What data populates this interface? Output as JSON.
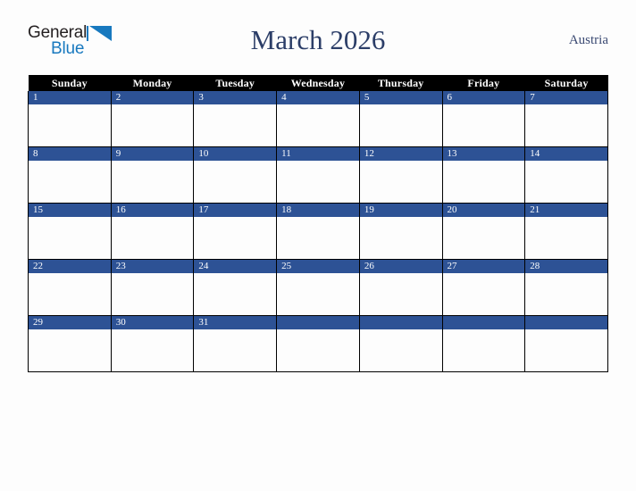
{
  "brand": {
    "name_part1": "General",
    "name_part2": "Blue",
    "accent_color": "#1879bf",
    "text_color": "#231f20"
  },
  "header": {
    "title": "March 2026",
    "region": "Austria",
    "title_color": "#2c3e68"
  },
  "calendar": {
    "month": "March",
    "year": "2026",
    "weekday_headers": [
      "Sunday",
      "Monday",
      "Tuesday",
      "Wednesday",
      "Thursday",
      "Friday",
      "Saturday"
    ],
    "header_bg": "#000000",
    "header_text_color": "#ffffff",
    "daynum_bg": "#2d5295",
    "daynum_text_color": "#ffffff",
    "cell_bg": "#fdfdfd",
    "weeks": [
      {
        "days": [
          {
            "num": "1"
          },
          {
            "num": "2"
          },
          {
            "num": "3"
          },
          {
            "num": "4"
          },
          {
            "num": "5"
          },
          {
            "num": "6"
          },
          {
            "num": "7"
          }
        ]
      },
      {
        "days": [
          {
            "num": "8"
          },
          {
            "num": "9"
          },
          {
            "num": "10"
          },
          {
            "num": "11"
          },
          {
            "num": "12"
          },
          {
            "num": "13"
          },
          {
            "num": "14"
          }
        ]
      },
      {
        "days": [
          {
            "num": "15"
          },
          {
            "num": "16"
          },
          {
            "num": "17"
          },
          {
            "num": "18"
          },
          {
            "num": "19"
          },
          {
            "num": "20"
          },
          {
            "num": "21"
          }
        ]
      },
      {
        "days": [
          {
            "num": "22"
          },
          {
            "num": "23"
          },
          {
            "num": "24"
          },
          {
            "num": "25"
          },
          {
            "num": "26"
          },
          {
            "num": "27"
          },
          {
            "num": "28"
          }
        ]
      },
      {
        "days": [
          {
            "num": "29"
          },
          {
            "num": "30"
          },
          {
            "num": "31"
          },
          {
            "num": ""
          },
          {
            "num": ""
          },
          {
            "num": ""
          },
          {
            "num": ""
          }
        ]
      }
    ]
  }
}
